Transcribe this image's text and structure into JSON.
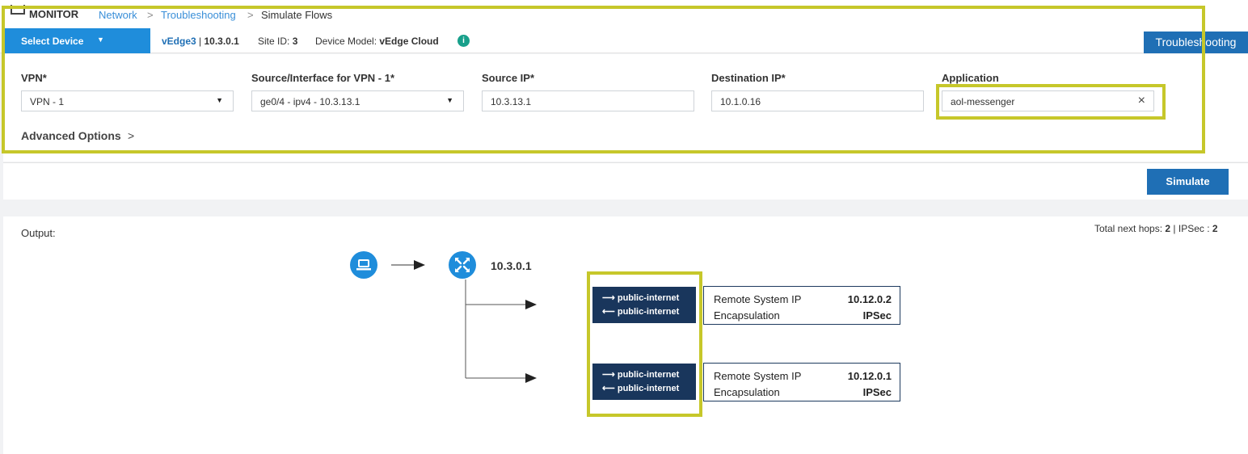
{
  "header": {
    "section_title": "MONITOR",
    "breadcrumb": [
      "Network",
      ">",
      "Troubleshooting",
      ">",
      "Simulate Flows"
    ]
  },
  "device_bar": {
    "select_device_label": "Select Device",
    "device_name": "vEdge3",
    "device_sep": " | ",
    "device_ip": "10.3.0.1",
    "site_label": "Site ID: ",
    "site_id": "3",
    "model_label": "Device Model: ",
    "model": "vEdge Cloud",
    "troubleshooting_label": "Troubleshooting"
  },
  "form": {
    "vpn_label": "VPN*",
    "vpn_value": "VPN - 1",
    "source_label": "Source/Interface for VPN - 1*",
    "source_value": "ge0/4 - ipv4 - 10.3.13.1",
    "source_ip_label": "Source IP*",
    "source_ip_value": "10.3.13.1",
    "dest_ip_label": "Destination IP*",
    "dest_ip_value": "10.1.0.16",
    "application_label": "Application",
    "application_value": "aol-messenger",
    "advanced_label": "Advanced Options",
    "advanced_chevron": ">"
  },
  "simulate_label": "Simulate",
  "output": {
    "label": "Output:",
    "hops_label": "Total next hops: ",
    "hops_value": "2",
    "hops_sep": " | IPSec : ",
    "ipsec_value": "2",
    "device_ip": "10.3.0.1",
    "paths": [
      {
        "out_arrow": "⟶",
        "out_color": "public-internet",
        "in_arrow": "⟵",
        "in_color": "public-internet",
        "remote_ip_label": "Remote System IP",
        "remote_ip": "10.12.0.2",
        "encap_label": "Encapsulation",
        "encap": "IPSec"
      },
      {
        "out_arrow": "⟶",
        "out_color": "public-internet",
        "in_arrow": "⟵",
        "in_color": "public-internet",
        "remote_ip_label": "Remote System IP",
        "remote_ip": "10.12.0.1",
        "encap_label": "Encapsulation",
        "encap": "IPSec"
      }
    ]
  },
  "colors": {
    "primary_blue": "#1f8ddb",
    "button_blue": "#1f6fb5",
    "tunnel_navy": "#19365c",
    "highlight": "#c6c72a",
    "info_green": "#18a08b"
  },
  "icons": {
    "monitor": "monitor-icon",
    "dropdown": "caret-down-icon",
    "info": "info-icon",
    "clear": "close-icon",
    "host": "laptop-icon",
    "router": "router-icon"
  }
}
